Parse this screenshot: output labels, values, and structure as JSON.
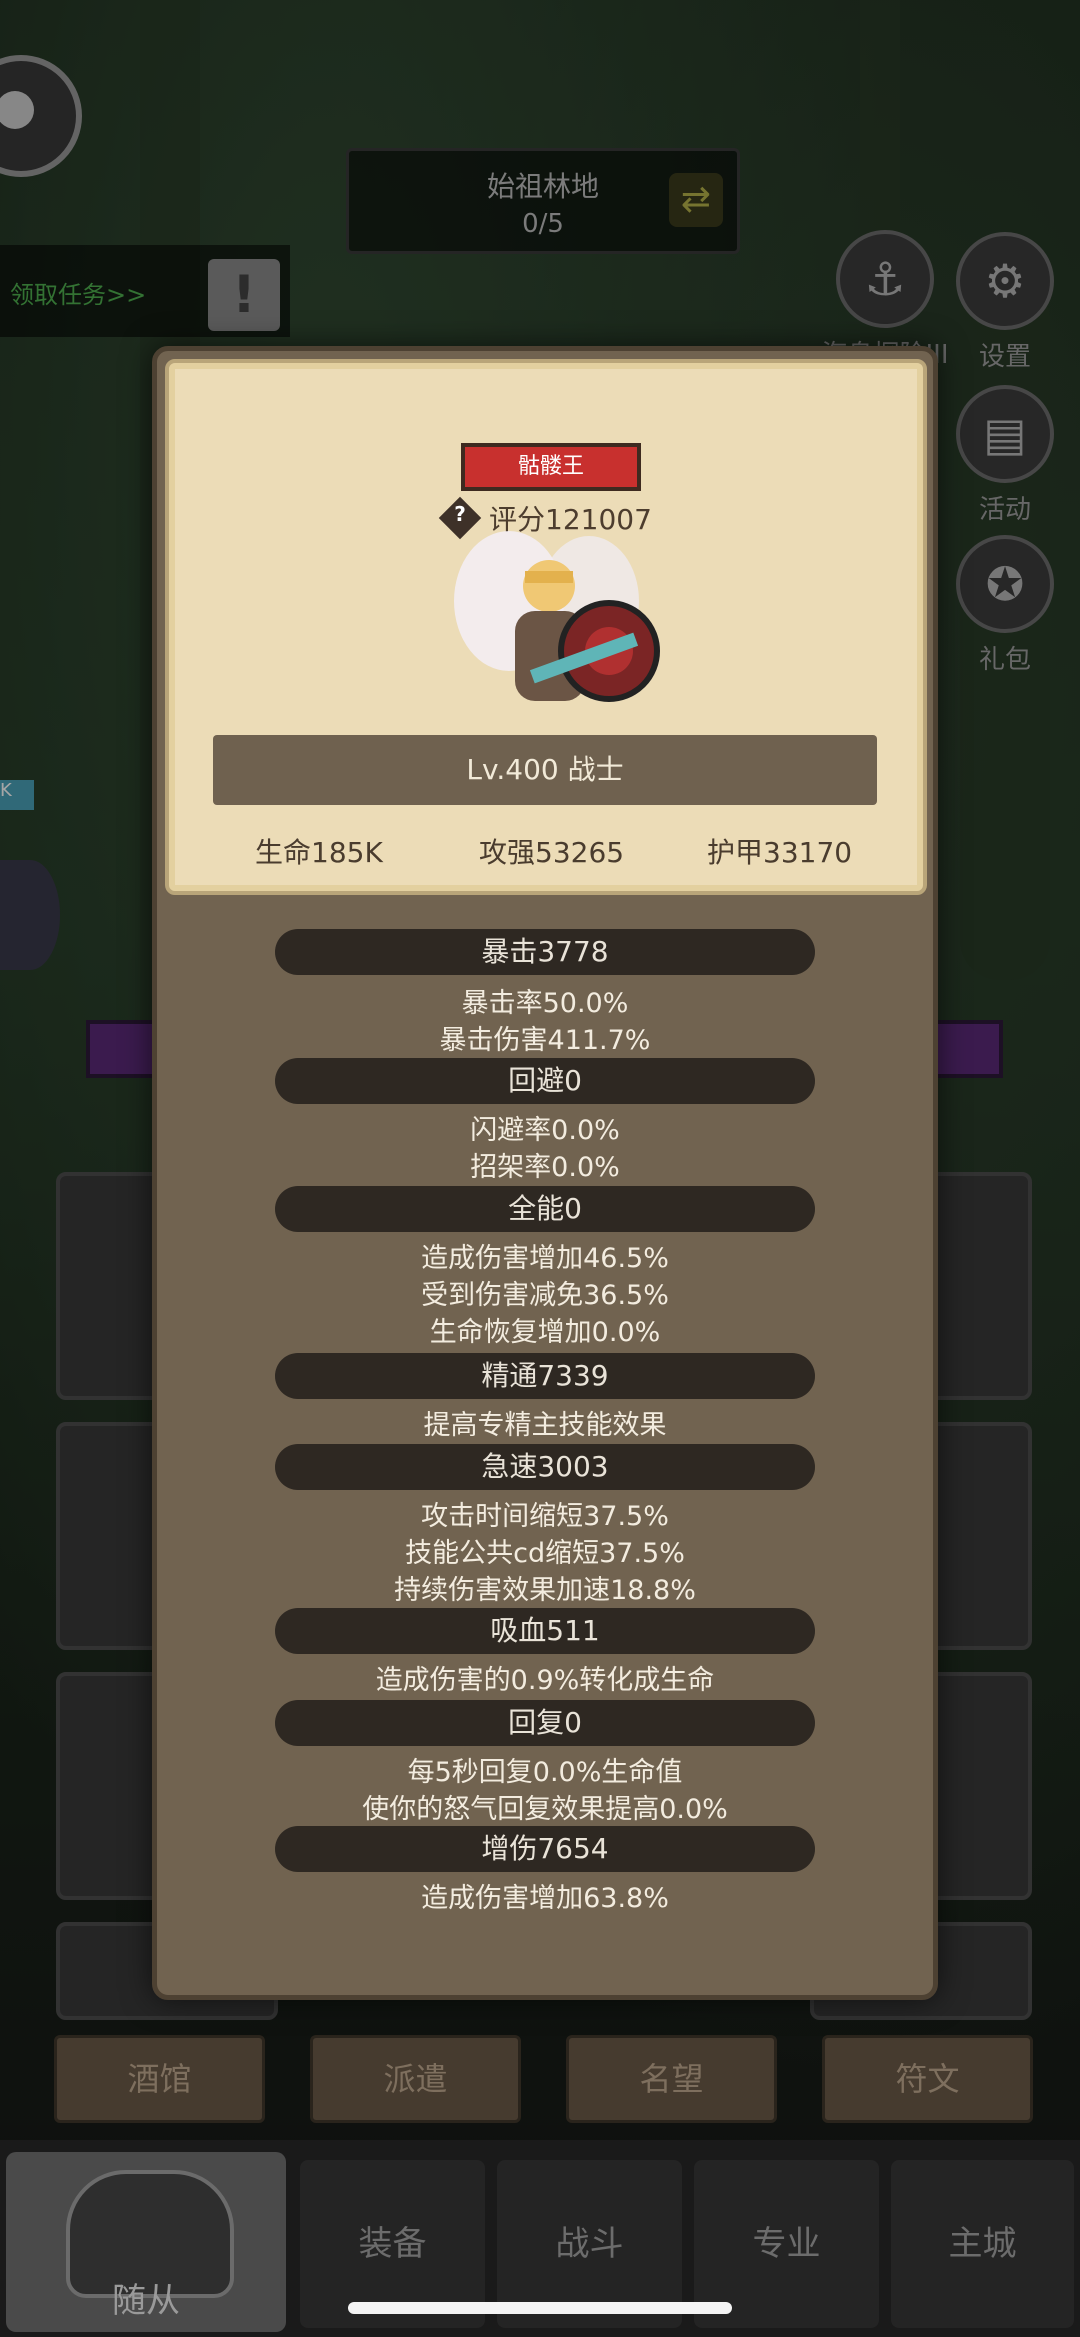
{
  "top": {
    "location_name": "始祖林地",
    "location_progress": "0/5",
    "quest_link": "领取任务>>"
  },
  "side_buttons": [
    {
      "label": "海岛探险III",
      "icon": "anchor-icon"
    },
    {
      "label": "设置",
      "icon": "gear-icon"
    },
    {
      "label": "活动",
      "icon": "scroll-icon"
    },
    {
      "label": "礼包",
      "icon": "giftbag-icon"
    }
  ],
  "left_tag": "K",
  "hero": {
    "title": "骷髅王",
    "score_label": "评分121007",
    "level_class": "Lv.400 战士",
    "base_stats": [
      "生命185K",
      "攻强53265",
      "护甲33170"
    ]
  },
  "stats": [
    {
      "header": "暴击3778",
      "lines": [
        "暴击率50.0%",
        "暴击伤害411.7%"
      ]
    },
    {
      "header": "回避0",
      "lines": [
        "闪避率0.0%",
        "招架率0.0%"
      ]
    },
    {
      "header": "全能0",
      "lines": [
        "造成伤害增加46.5%",
        "受到伤害减免36.5%",
        "生命恢复增加0.0%"
      ]
    },
    {
      "header": "精通7339",
      "lines": [
        "提高专精主技能效果"
      ]
    },
    {
      "header": "急速3003",
      "lines": [
        "攻击时间缩短37.5%",
        "技能公共cd缩短37.5%",
        "持续伤害效果加速18.8%"
      ]
    },
    {
      "header": "吸血511",
      "lines": [
        "造成伤害的0.9%转化成生命"
      ]
    },
    {
      "header": "回复0",
      "lines": [
        "每5秒回复0.0%生命值",
        "使你的怒气回复效果提高0.0%"
      ]
    },
    {
      "header": "增伤7654",
      "lines": [
        "造成伤害增加63.8%"
      ]
    }
  ],
  "function_tabs": [
    "酒馆",
    "派遣",
    "名望",
    "符文"
  ],
  "bottom_nav": [
    "随从",
    "装备",
    "战斗",
    "专业",
    "主城"
  ],
  "colors": {
    "modal_bg": "#716350",
    "card_bg": "#ecdcb7",
    "title_red": "#c8302e",
    "header_dark": "#2e2822"
  }
}
